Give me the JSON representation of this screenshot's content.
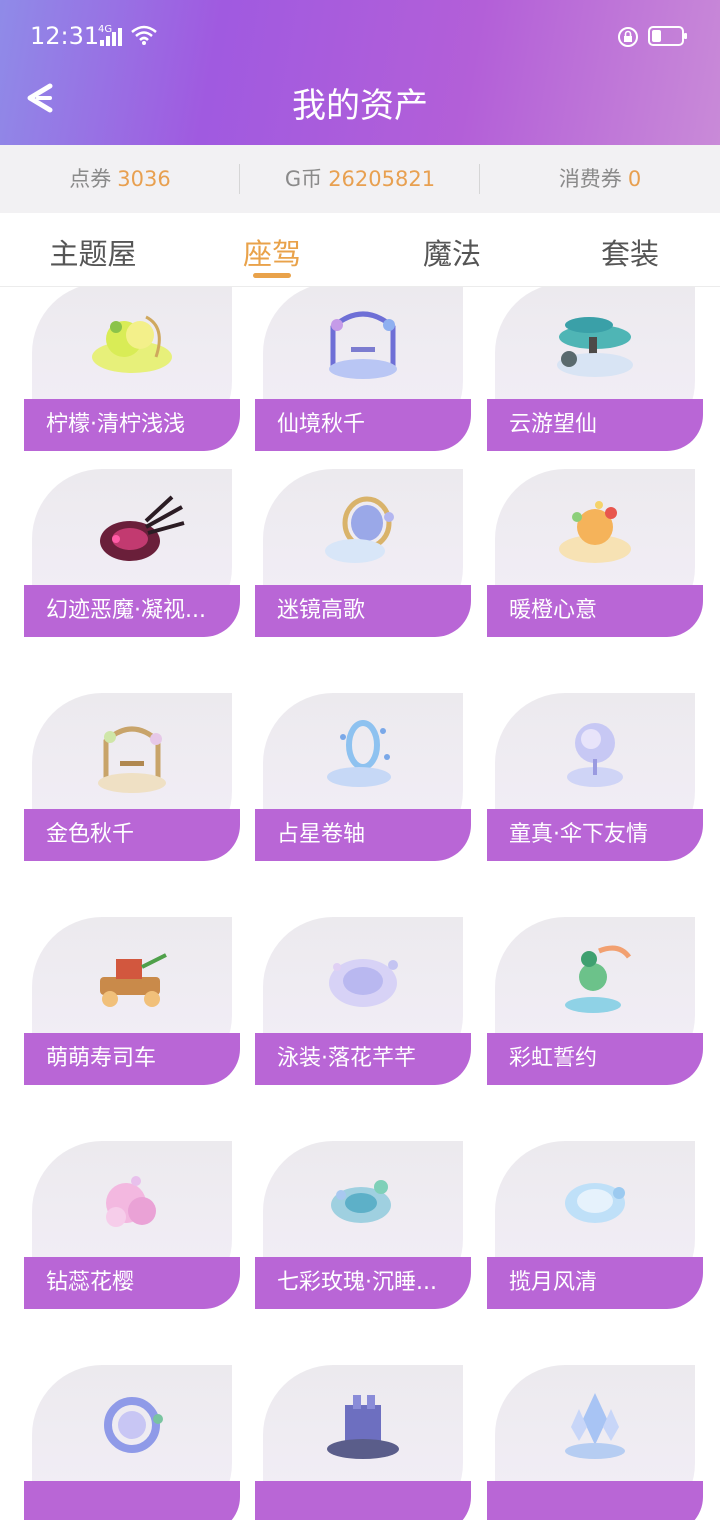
{
  "status_bar": {
    "time": "12:31",
    "network": "4G"
  },
  "header": {
    "title": "我的资产"
  },
  "assets": [
    {
      "label": "点券",
      "value": "3036"
    },
    {
      "label": "G币",
      "value": "26205821"
    },
    {
      "label": "消费券",
      "value": "0"
    }
  ],
  "tabs": [
    {
      "label": "主题屋"
    },
    {
      "label": "座驾",
      "active": true
    },
    {
      "label": "魔法"
    },
    {
      "label": "套装"
    }
  ],
  "items": [
    {
      "name": "柠檬·清柠浅浅",
      "icon": "lemon-mount-icon"
    },
    {
      "name": "仙境秋千",
      "icon": "swing-mount-icon"
    },
    {
      "name": "云游望仙",
      "icon": "pine-cloud-mount-icon"
    },
    {
      "name": "幻迹恶魔·凝视...",
      "icon": "devil-mount-icon"
    },
    {
      "name": "迷镜高歌",
      "icon": "mirror-mount-icon"
    },
    {
      "name": "暖橙心意",
      "icon": "orange-mount-icon"
    },
    {
      "name": "金色秋千",
      "icon": "golden-swing-mount-icon"
    },
    {
      "name": "占星卷轴",
      "icon": "scroll-mount-icon"
    },
    {
      "name": "童真·伞下友情",
      "icon": "umbrella-mount-icon"
    },
    {
      "name": "萌萌寿司车",
      "icon": "sushi-car-mount-icon"
    },
    {
      "name": "泳装·落花芊芊",
      "icon": "petal-mount-icon"
    },
    {
      "name": "彩虹誓约",
      "icon": "rainbow-mount-icon"
    },
    {
      "name": "钻蕊花樱",
      "icon": "sakura-mount-icon"
    },
    {
      "name": "七彩玫瑰·沉睡...",
      "icon": "rose-mount-icon"
    },
    {
      "name": "揽月风清",
      "icon": "moon-mount-icon"
    },
    {
      "name": "",
      "icon": "wreath-mount-icon"
    },
    {
      "name": "",
      "icon": "castle-mount-icon"
    },
    {
      "name": "",
      "icon": "crystal-mount-icon"
    }
  ],
  "colors": {
    "accent": "#e9a24a",
    "label_bg": "#b966d6",
    "header_start": "#8f8be8",
    "header_end": "#c98ad8"
  }
}
